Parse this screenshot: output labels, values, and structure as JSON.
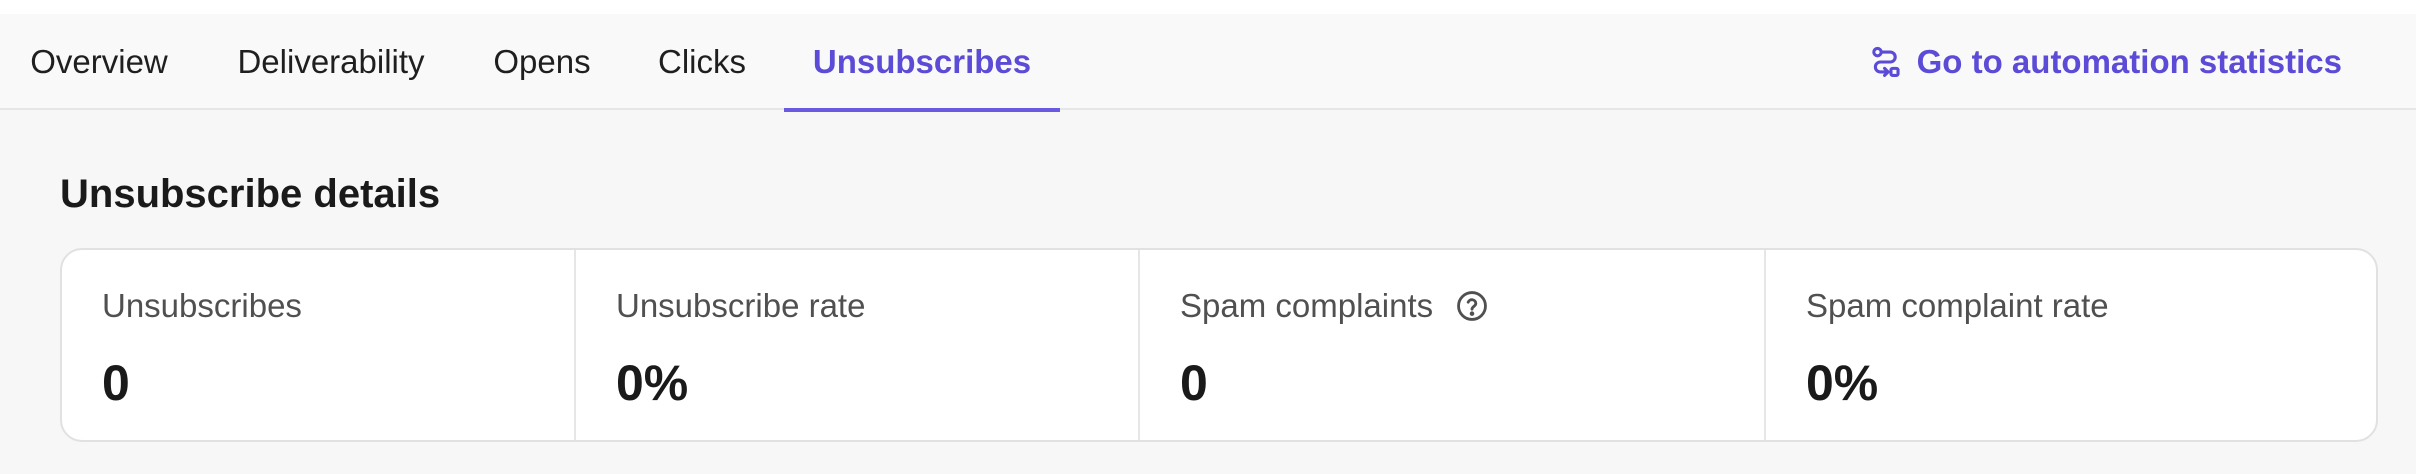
{
  "tabs": {
    "overview": "Overview",
    "deliverability": "Deliverability",
    "opens": "Opens",
    "clicks": "Clicks",
    "unsubscribes": "Unsubscribes",
    "active": "Unsubscribes"
  },
  "automation_link": {
    "label": "Go to automation statistics",
    "icon": "automation-flow-icon"
  },
  "section": {
    "title": "Unsubscribe details"
  },
  "stats": {
    "unsubscribes": {
      "label": "Unsubscribes",
      "value": "0"
    },
    "unsubscribe_rate": {
      "label": "Unsubscribe rate",
      "value": "0%"
    },
    "spam_complaints": {
      "label": "Spam complaints",
      "value": "0",
      "help_icon": "question-circle-icon"
    },
    "spam_complaint_rate": {
      "label": "Spam complaint rate",
      "value": "0%"
    }
  },
  "colors": {
    "accent": "#5b4bd6",
    "underline": "#6a5ae0",
    "background": "#f7f7f7",
    "card": "#ffffff"
  }
}
